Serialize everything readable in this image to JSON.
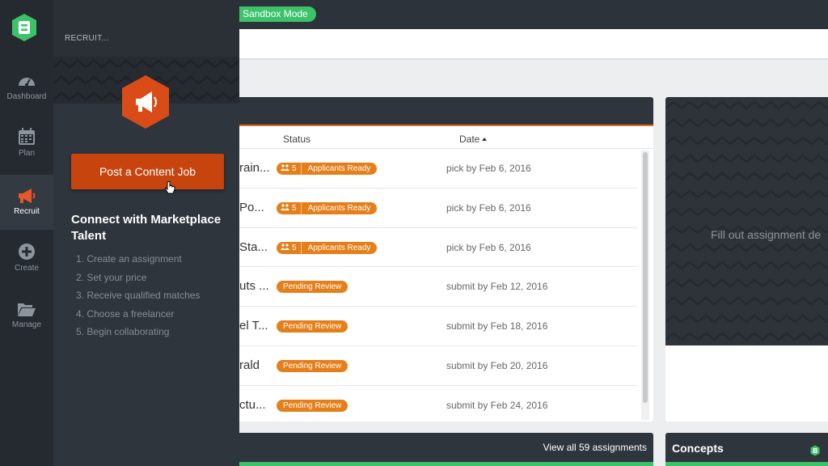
{
  "topbar": {
    "sandbox_label": "Sandbox Mode"
  },
  "nav": {
    "items": [
      {
        "label": "Dashboard",
        "icon": "gauge-icon"
      },
      {
        "label": "Plan",
        "icon": "calendar-icon"
      },
      {
        "label": "Recruit",
        "icon": "megaphone-icon",
        "active": true
      },
      {
        "label": "Create",
        "icon": "plus-circle-icon"
      },
      {
        "label": "Manage",
        "icon": "folder-open-icon"
      }
    ]
  },
  "flyout": {
    "header": "RECRUIT...",
    "post_button": "Post a Content Job",
    "connect_title": "Connect with Marketplace Talent",
    "steps": [
      "1.  Create an assignment",
      "2.  Set your price",
      "3.  Receive qualified matches",
      "4.  Choose a freelancer",
      "5.  Begin collaborating"
    ]
  },
  "assignments": {
    "columns": {
      "status": "Status",
      "date": "Date"
    },
    "rows": [
      {
        "title": "rain...",
        "count": "5",
        "status": "Applicants Ready",
        "date": "pick by Feb 6, 2016"
      },
      {
        "title": " Po...",
        "count": "5",
        "status": "Applicants Ready",
        "date": "pick by Feb 6, 2016"
      },
      {
        "title": " Sta...",
        "count": "5",
        "status": "Applicants Ready",
        "date": "pick by Feb 6, 2016"
      },
      {
        "title": "uts ...",
        "count": "",
        "status": "Pending Review",
        "date": "submit by Feb 12, 2016"
      },
      {
        "title": "el T...",
        "count": "",
        "status": "Pending Review",
        "date": "submit by Feb 18, 2016"
      },
      {
        "title": "rald",
        "count": "",
        "status": "Pending Review",
        "date": "submit by Feb 20, 2016"
      },
      {
        "title": "ctu...",
        "count": "",
        "status": "Pending Review",
        "date": "submit by Feb 24, 2016"
      }
    ],
    "view_all": "View all 59 assignments"
  },
  "side_card": {
    "text": "Fill out assignment de"
  },
  "concepts": {
    "title": "Concepts"
  },
  "colors": {
    "accent_orange": "#e57f1a",
    "brand_green": "#3cc36a",
    "button_red": "#c8440f"
  }
}
